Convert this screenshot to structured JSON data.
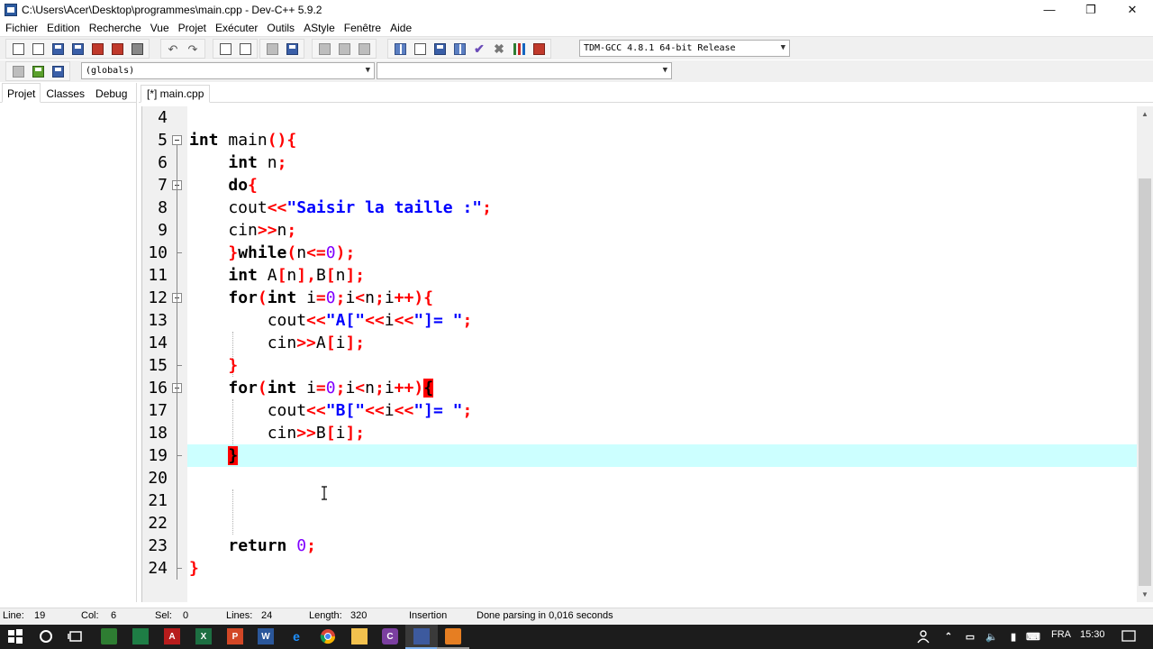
{
  "window": {
    "title": "C:\\Users\\Acer\\Desktop\\programmes\\main.cpp - Dev-C++ 5.9.2",
    "minimize": "—",
    "restore": "❐",
    "close": "✕"
  },
  "menu": [
    "Fichier",
    "Edition",
    "Recherche",
    "Vue",
    "Projet",
    "Exécuter",
    "Outils",
    "AStyle",
    "Fenêtre",
    "Aide"
  ],
  "toolbar": {
    "compiler": "TDM-GCC 4.8.1 64-bit Release",
    "scope": "(globals)",
    "member": ""
  },
  "left_tabs": [
    "Projet",
    "Classes",
    "Debug"
  ],
  "editor_tab": "[*] main.cpp",
  "code": {
    "line_numbers": [
      "4",
      "5",
      "6",
      "7",
      "8",
      "9",
      "10",
      "11",
      "12",
      "13",
      "14",
      "15",
      "16",
      "17",
      "18",
      "19",
      "20",
      "21",
      "22",
      "23",
      "24"
    ],
    "current_line": "19"
  },
  "status": {
    "line_label": "Line:",
    "line_value": "19",
    "col_label": "Col:",
    "col_value": "6",
    "sel_label": "Sel:",
    "sel_value": "0",
    "lines_label": "Lines:",
    "lines_value": "24",
    "length_label": "Length:",
    "length_value": "320",
    "mode": "Insertion",
    "message": "Done parsing in 0,016 seconds"
  },
  "taskbar": {
    "language": "FRA",
    "time": "15:30"
  },
  "colors": {
    "keyword": "#000000",
    "punctuation": "#ff0000",
    "string": "#0000ff",
    "number": "#8000ff",
    "active_line": "#ccffff"
  }
}
